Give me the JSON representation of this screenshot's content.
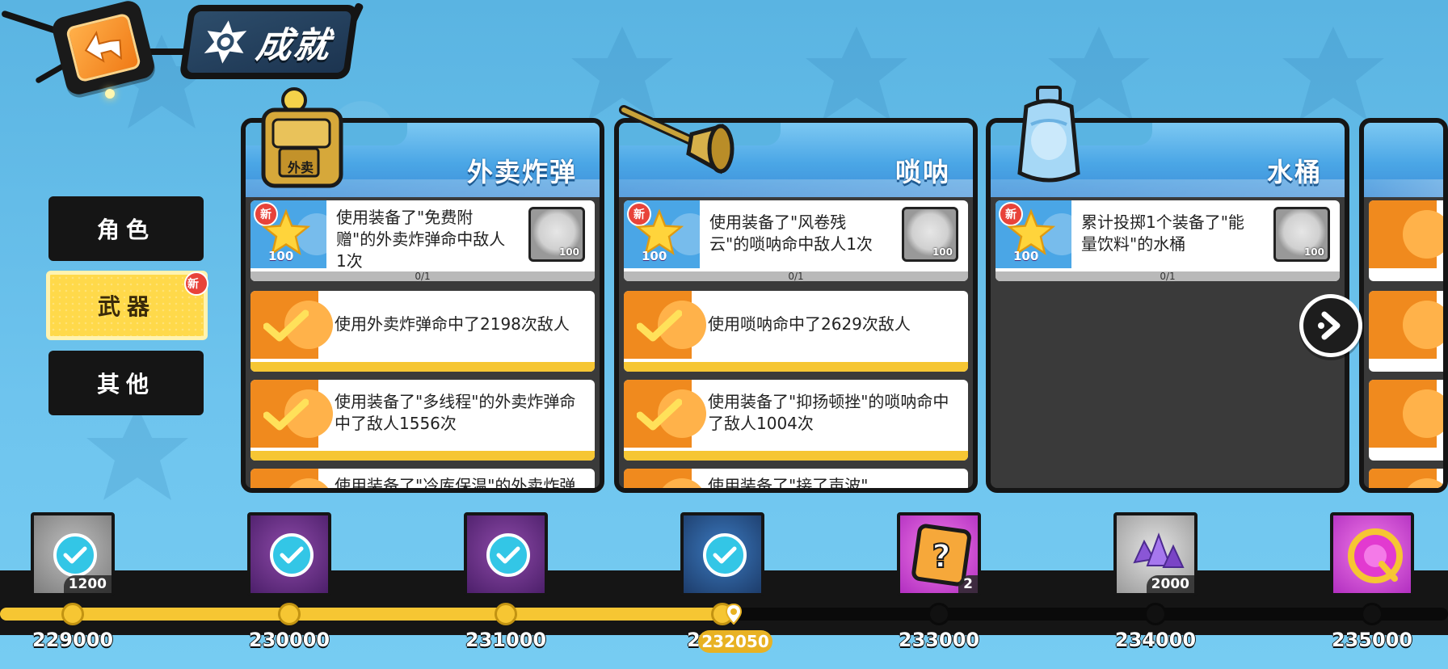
{
  "header": {
    "title": "成就",
    "back_icon": "back-arrow-icon",
    "title_icon": "star-badge-icon"
  },
  "side_tabs": [
    {
      "label": "角色",
      "active": false
    },
    {
      "label": "武器",
      "active": true,
      "badge": "新"
    },
    {
      "label": "其他",
      "active": false
    }
  ],
  "cards": [
    {
      "title": "外卖炸弹",
      "icon": "delivery-bomb-backpack-icon",
      "icon_label": "外卖",
      "items": [
        {
          "new_badge": "新",
          "star_points": "100",
          "text": "使用装备了\"免费附赠\"的外卖炸弹命中敌人1次",
          "reward_icon": "gold-coins-icon",
          "reward_amount": "100",
          "progress": "0/1",
          "done": false
        },
        {
          "text": "使用外卖炸弹命中了2198次敌人",
          "done": true
        },
        {
          "text": "使用装备了\"多线程\"的外卖炸弹命中了敌人1556次",
          "done": true
        },
        {
          "text": "使用装备了\"冷库保温\"的外卖炸弹",
          "done": true
        }
      ]
    },
    {
      "title": "唢呐",
      "icon": "suona-horn-icon",
      "items": [
        {
          "new_badge": "新",
          "star_points": "100",
          "text": "使用装备了\"风卷残云\"的唢呐命中敌人1次",
          "reward_icon": "gold-coins-icon",
          "reward_amount": "100",
          "progress": "0/1",
          "done": false
        },
        {
          "text": "使用唢呐命中了2629次敌人",
          "done": true
        },
        {
          "text": "使用装备了\"抑扬顿挫\"的唢呐命中了敌人1004次",
          "done": true
        },
        {
          "text": "使用装备了\"接了声波\"",
          "done": true
        }
      ]
    },
    {
      "title": "水桶",
      "icon": "water-bottle-icon",
      "items": [
        {
          "new_badge": "新",
          "star_points": "100",
          "text": "累计投掷1个装备了\"能量饮料\"的水桶",
          "reward_icon": "gold-coins-icon",
          "reward_amount": "100",
          "progress": "0/1",
          "done": false
        }
      ]
    }
  ],
  "milestones": [
    {
      "value": "229000",
      "reward_amount": "1200",
      "style": "gray",
      "claimed": true,
      "reached": true
    },
    {
      "value": "230000",
      "reward_amount": "",
      "style": "purple",
      "claimed": true,
      "reached": true
    },
    {
      "value": "231000",
      "reward_amount": "",
      "style": "purple",
      "claimed": true,
      "reached": true
    },
    {
      "value": "232000",
      "reward_amount": "",
      "style": "blue",
      "claimed": true,
      "reached": true
    },
    {
      "value": "233000",
      "reward_amount": "2",
      "style": "pink",
      "claimed": false,
      "reached": false,
      "reward_icon": "mystery-box-icon"
    },
    {
      "value": "234000",
      "reward_amount": "2000",
      "style": "silver",
      "claimed": false,
      "reached": false,
      "reward_icon": "purple-crystals-icon"
    },
    {
      "value": "235000",
      "reward_amount": "",
      "style": "pink",
      "claimed": false,
      "reached": false,
      "reward_icon": "q-token-icon"
    }
  ],
  "current_score": "232050",
  "colors": {
    "accent_yellow": "#f6c633",
    "tab_active": "#ffd94a",
    "card_header_blue": "#4aa6e6",
    "done_orange": "#f08a1e",
    "new_red": "#e8433a"
  }
}
